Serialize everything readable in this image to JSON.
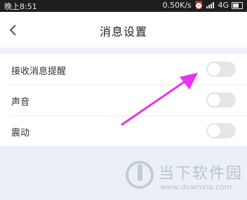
{
  "status_bar": {
    "time": "晚上8:51",
    "network_speed": "0.50K/s",
    "network_type": "4G"
  },
  "header": {
    "title": "消息设置",
    "back_icon": "chevron-left-icon"
  },
  "settings": [
    {
      "label": "接收消息提醒",
      "enabled": false
    },
    {
      "label": "声音",
      "enabled": false
    },
    {
      "label": "震动",
      "enabled": false
    }
  ],
  "annotation": {
    "color": "#e634ee"
  },
  "watermark": {
    "title": "当下软件园",
    "url": "www.downxia.com"
  },
  "colors": {
    "status_bg": "#1e1e1e",
    "toggle_off": "#e6e6e6",
    "page_bg": "#eaf0f6"
  }
}
